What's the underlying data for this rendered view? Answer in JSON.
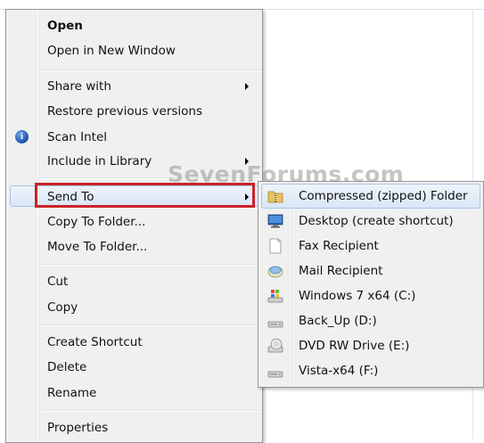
{
  "context_menu": {
    "items": [
      {
        "label": "Open"
      },
      {
        "label": "Open in New Window"
      },
      {
        "label": "Share with"
      },
      {
        "label": "Restore previous versions"
      },
      {
        "label": "Scan Intel"
      },
      {
        "label": "Include in Library"
      },
      {
        "label": "Send To"
      },
      {
        "label": "Copy To Folder..."
      },
      {
        "label": "Move To Folder..."
      },
      {
        "label": "Cut"
      },
      {
        "label": "Copy"
      },
      {
        "label": "Create Shortcut"
      },
      {
        "label": "Delete"
      },
      {
        "label": "Rename"
      },
      {
        "label": "Properties"
      }
    ]
  },
  "send_to_submenu": {
    "items": [
      {
        "label": "Compressed (zipped) Folder",
        "icon": "zip-folder-icon"
      },
      {
        "label": "Desktop (create shortcut)",
        "icon": "desktop-icon"
      },
      {
        "label": "Fax Recipient",
        "icon": "fax-document-icon"
      },
      {
        "label": "Mail Recipient",
        "icon": "mail-icon"
      },
      {
        "label": "Windows 7 x64 (C:)",
        "icon": "windows-drive-icon"
      },
      {
        "label": "Back_Up (D:)",
        "icon": "hard-drive-icon"
      },
      {
        "label": "DVD RW Drive (E:)",
        "icon": "dvd-drive-icon"
      },
      {
        "label": "Vista-x64 (F:)",
        "icon": "hard-drive-icon"
      }
    ]
  },
  "watermark": "SevenForums.com",
  "colors": {
    "highlight_outline": "#cc2229",
    "menu_background": "#f0f0f0",
    "hover_border": "#a8c5e6"
  }
}
